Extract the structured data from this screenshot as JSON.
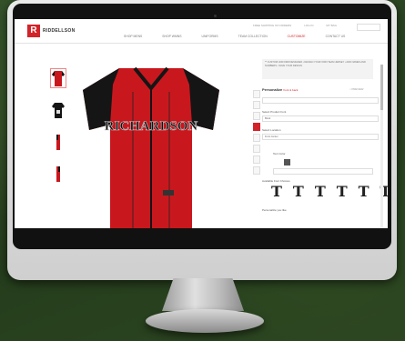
{
  "brand": {
    "logo_letter": "R",
    "name": "RIDDELLSON",
    "accent": "#d2232a"
  },
  "nav": {
    "items": [
      "SHOP MENS",
      "SHOP WMNS",
      "UNIFORMS",
      "TEAM COLLECTION",
      "CUSTOMIZE",
      "CONTACT US"
    ],
    "active_index": 4
  },
  "utility": {
    "items": [
      "FREE SHIPPING ON ORDERS",
      "LOG IN",
      "MY BAG"
    ]
  },
  "thumbnails": [
    "front-view",
    "back-view",
    "left-side-view",
    "right-side-view"
  ],
  "jersey": {
    "name_text": "RICHARDSON",
    "body_color": "#c8181e",
    "sleeve_color": "#151515"
  },
  "panel": {
    "notice": "** CUSTOM UNIFORM DESIGNER  • DESIGN YOUR OWN TEAM JERSEY • ADD NAMES AND NUMBERS • SAVE YOUR DESIGN",
    "title": "Personalize",
    "title_tag": "front & back",
    "preview": "○ PREVIEW",
    "fields": [
      {
        "label": "Select Product Font",
        "value": "Block"
      },
      {
        "label": "Select Location",
        "value": "Front Center"
      },
      {
        "label": "Text Color",
        "value": ""
      }
    ],
    "font_label": "Available Font Choices",
    "font_choices": [
      "T",
      "T",
      "T",
      "T",
      "T",
      "T"
    ],
    "footer_label": "Personalize you like"
  }
}
